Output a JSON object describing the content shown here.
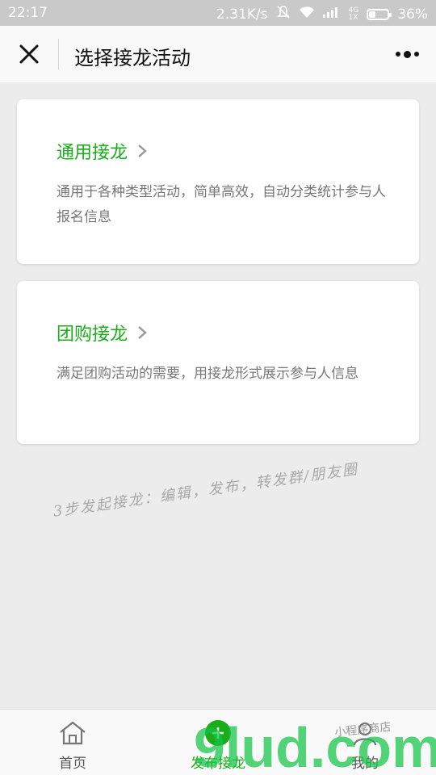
{
  "status_bar": {
    "time": "22:17",
    "speed": "2.31K/s",
    "network": "4G",
    "network_sub": "1X",
    "battery": "36%",
    "battery_level": 0.36
  },
  "nav": {
    "title": "选择接龙活动",
    "close_icon": "close-icon",
    "more_icon": "more-icon"
  },
  "cards": [
    {
      "title": "通用接龙",
      "desc": "通用于各种类型活动，简单高效，自动分类统计参与人报名信息"
    },
    {
      "title": "团购接龙",
      "desc": "满足团购活动的需要，用接龙形式展示参与人信息"
    }
  ],
  "handwritten_note": "3步发起接龙：编辑，发布，转发群/朋友圈",
  "tabs": [
    {
      "label": "首页",
      "icon": "home-icon"
    },
    {
      "label": "发布接龙",
      "icon": "plus-icon"
    },
    {
      "label": "我的",
      "icon": "person-icon"
    }
  ],
  "watermark": {
    "logo": "9lud.com",
    "tagline": "小程序商店"
  },
  "colors": {
    "accent": "#1aad19",
    "background": "#ececec",
    "status_bar": "#c9c9c9"
  }
}
